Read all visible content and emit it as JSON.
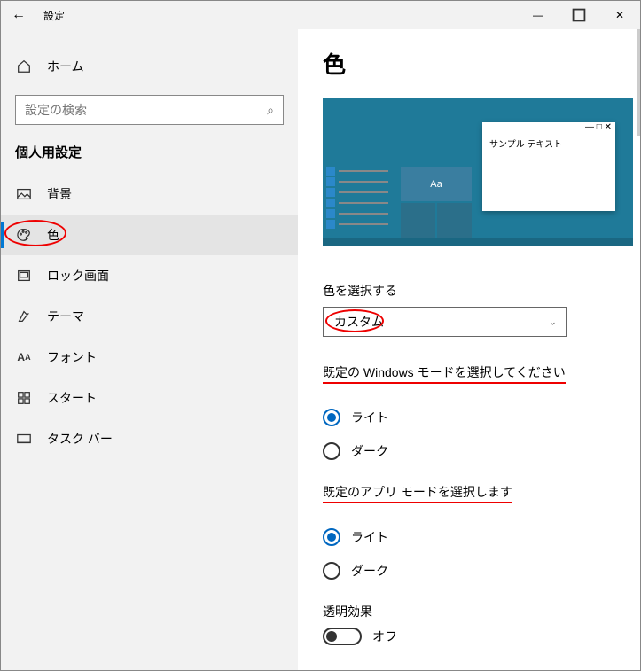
{
  "titlebar": {
    "title": "設定"
  },
  "sidebar": {
    "home_label": "ホーム",
    "search_placeholder": "設定の検索",
    "section_label": "個人用設定",
    "items": [
      {
        "label": "背景"
      },
      {
        "label": "色"
      },
      {
        "label": "ロック画面"
      },
      {
        "label": "テーマ"
      },
      {
        "label": "フォント"
      },
      {
        "label": "スタート"
      },
      {
        "label": "タスク バー"
      }
    ]
  },
  "main": {
    "heading": "色",
    "preview_label": "サンプル テキスト",
    "preview_tile_text": "Aa",
    "choose_color_label": "色を選択する",
    "choose_color_value": "カスタム",
    "windows_mode_label": "既定の Windows モードを選択してください",
    "app_mode_label": "既定のアプリ モードを選択します",
    "radio_light": "ライト",
    "radio_dark": "ダーク",
    "transparency_label": "透明効果",
    "transparency_value": "オフ"
  }
}
